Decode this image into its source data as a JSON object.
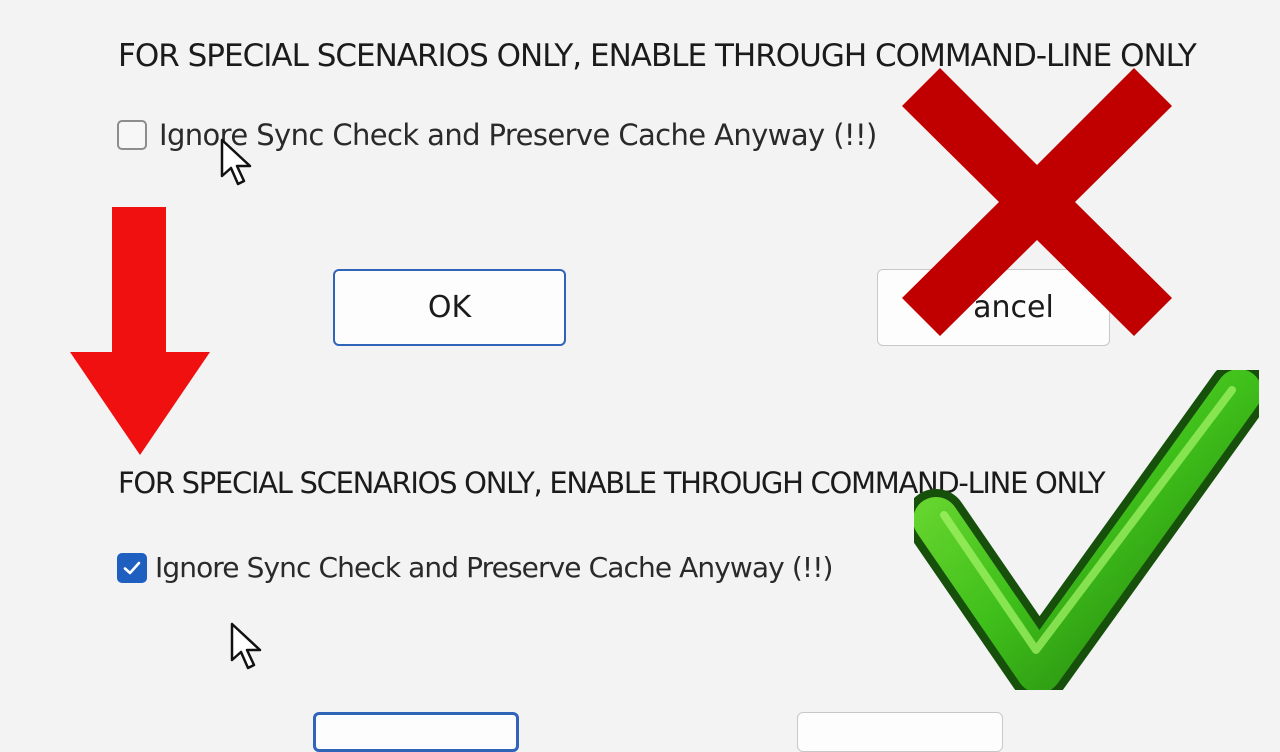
{
  "top_section": {
    "heading": "FOR SPECIAL SCENARIOS ONLY, ENABLE THROUGH COMMAND-LINE ONLY",
    "option_label": "Ignore Sync Check and Preserve Cache Anyway (!!)",
    "option_checked": false,
    "ok_label": "OK",
    "cancel_label": "ancel"
  },
  "bottom_section": {
    "heading": "FOR SPECIAL SCENARIOS ONLY, ENABLE THROUGH COMMAND-LINE ONLY",
    "option_label": "Ignore Sync Check and Preserve Cache Anyway (!!)",
    "option_checked": true
  },
  "overlays": {
    "arrow_icon": "arrow-down-icon",
    "x_icon": "cross-mark-icon",
    "check_icon": "check-mark-icon"
  },
  "colors": {
    "accent": "#1f5fbf",
    "arrow_red": "#f01010",
    "x_red": "#c00000",
    "check_green": "#3fbf1a"
  }
}
